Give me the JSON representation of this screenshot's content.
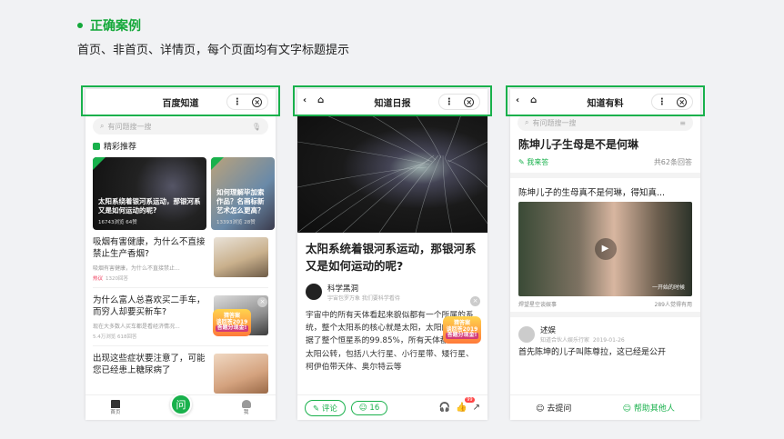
{
  "header": {
    "title": "正确案例",
    "desc": "首页、非首页、详情页，每个页面均有文字标题提示"
  },
  "colors": {
    "accent": "#19b14c"
  },
  "p1": {
    "title": "百度知道",
    "search": "有问题搜一搜",
    "section": "精彩推荐",
    "cards": [
      {
        "title": "太阳系绕着银河系运动，那银河系又是如何运动的呢?",
        "meta": "16743浏览 64赞"
      },
      {
        "title": "如何理解毕加索作品？名画标新艺术怎么更高？",
        "meta": "13393浏览 28赞"
      }
    ],
    "items": [
      {
        "q": "吸烟有害健康，为什么不直接禁止生产香烟?",
        "d": "吸烟有害健康，为什么不直接禁止...",
        "hot": "热议",
        "meta": "1320回答"
      },
      {
        "q": "为什么富人总喜欢买二手车，而穷人却要买新车?",
        "d": "现在大多数人买车都是看经济情况...",
        "meta": "5.4万浏览 618回答"
      },
      {
        "q": "出现这些症状要注意了，可能您已经患上糖尿病了",
        "d": "",
        "meta": ""
      }
    ],
    "sticker": {
      "top": "猜答案",
      "mid": "谈回答2019",
      "bot": "答题分现金!"
    },
    "tabs": {
      "home": "首页",
      "ask": "问",
      "me": "我"
    }
  },
  "p2": {
    "title": "知道日报",
    "article_title": "太阳系统着银河系运动，那银河系又是如何运动的呢?",
    "author": "科学黑洞",
    "author_sub": "宇宙包罗万象 我们要科学看待",
    "body": "宇宙中的所有天体看起来貌似都有一个所属的系统，整个太阳系的核心就是太阳，太阳的质量占据了整个恒星系的99.85%，所有天体都在绕着太阳公转，包括八大行星、小行星带、矮行星、柯伊伯带天体、奥尔特云等",
    "sticker": {
      "top": "猜答案",
      "mid": "谈回答2019",
      "bot": "答题分现金!"
    },
    "comment": "评论",
    "likes": "16",
    "badge": "99"
  },
  "p3": {
    "title": "知道有料",
    "search": "有问题搜一搜",
    "question": "陈坤儿子生母是不是何琳",
    "answer_btn": "我来答",
    "answers_count": "共62条回答",
    "teaser": "陈坤儿子的生母真不是何琳，得知真...",
    "subtitle": "一开始的时候",
    "vsource": "焊望星空谈娱事",
    "vuseful": "289人觉得有用",
    "user": "述娱",
    "user_sub": "知道合伙人娱乐行家",
    "date": "2019-01-26",
    "answer_text": "首先陈坤的儿子叫陈尊拉，这已经是公开",
    "ask": "去提问",
    "help": "帮助其他人"
  }
}
